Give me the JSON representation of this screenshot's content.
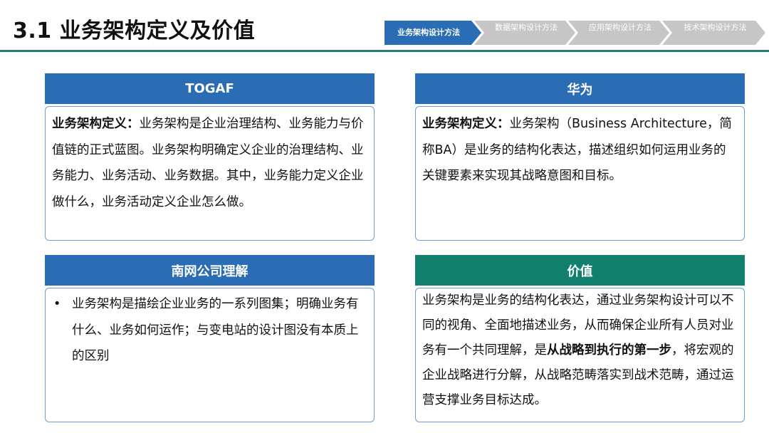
{
  "page_title": "3.1 业务架构定义及价值",
  "nav": [
    {
      "label": "业务架构设计方法",
      "active": true
    },
    {
      "label": "数据架构设计方法",
      "active": false
    },
    {
      "label": "应用架构设计方法",
      "active": false
    },
    {
      "label": "技术架构设计方法",
      "active": false
    }
  ],
  "cards": {
    "togaf": {
      "title": "TOGAF",
      "lead": "业务架构定义：",
      "text": "业务架构是企业治理结构、业务能力与价值链的正式蓝图。业务架构明确定义企业的治理结构、业务能力、业务活动、业务数据。其中，业务能力定义企业做什么，业务活动定义企业怎么做。"
    },
    "huawei": {
      "title": "华为",
      "lead": "业务架构定义：",
      "text": "业务架构（Business Architecture，简称BA）是业务的结构化表达，描述组织如何运用业务的关键要素来实现其战略意图和目标。"
    },
    "southern_grid": {
      "title": "南网公司理解",
      "bullet": "业务架构是描绘企业业务的一系列图集；明确业务有什么、业务如何运作；与变电站的设计图没有本质上的区别"
    },
    "value": {
      "title": "价值",
      "text_before": "业务架构是业务的结构化表达，通过业务架构设计可以不同的视角、全面地描述业务，从而确保企业所有人员对业务有一个共同理解，是",
      "text_bold": "从战略到执行的第一步",
      "text_after": "，将宏观的企业战略进行分解，从战略范畴落实到战术范畴，通过运营支撑业务目标达成。"
    }
  },
  "colors": {
    "header_blue": "#2a6db5",
    "header_teal": "#12806f",
    "rule_teal": "#2a7c74",
    "nav_inactive": "#c6c6c6"
  }
}
